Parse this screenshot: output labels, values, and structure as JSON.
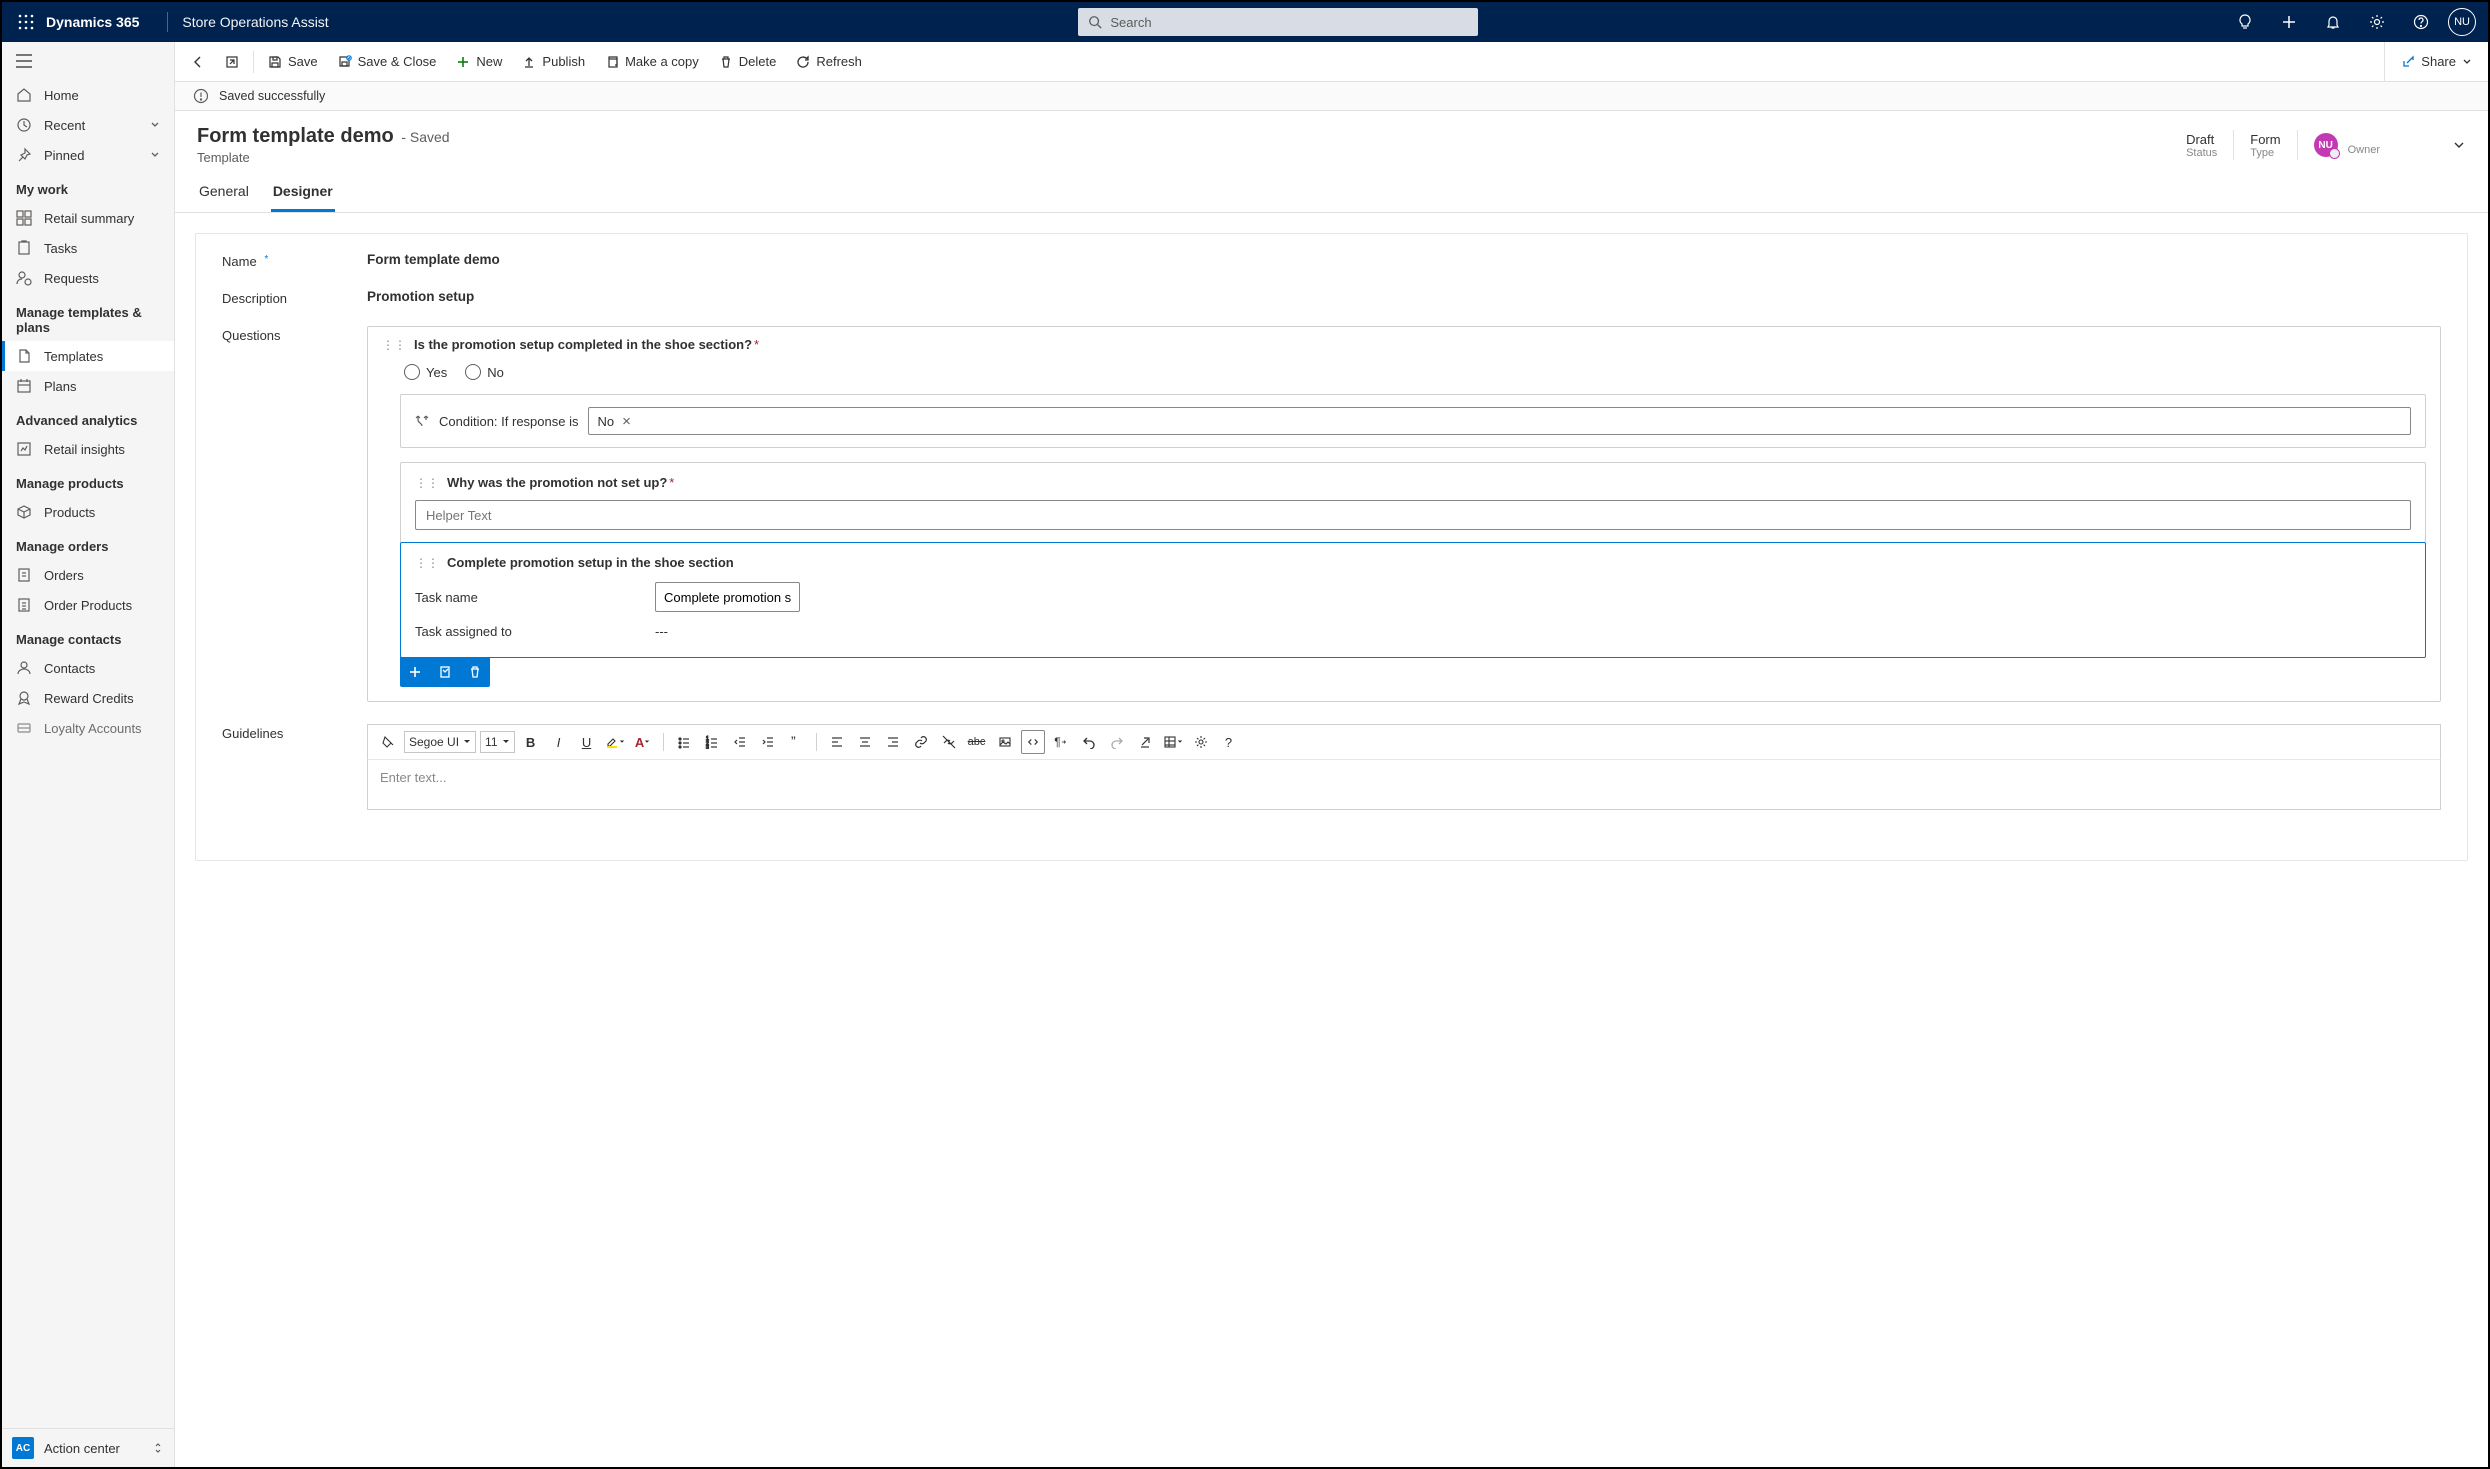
{
  "appbar": {
    "brand": "Dynamics 365",
    "appname": "Store Operations Assist",
    "search_placeholder": "Search",
    "user_initials": "NU"
  },
  "sidebar": {
    "top": [
      {
        "label": "Home",
        "icon": "home"
      },
      {
        "label": "Recent",
        "icon": "clock",
        "chev": true
      },
      {
        "label": "Pinned",
        "icon": "pin",
        "chev": true
      }
    ],
    "sections": [
      {
        "title": "My work",
        "items": [
          {
            "label": "Retail summary",
            "icon": "dashboard"
          },
          {
            "label": "Tasks",
            "icon": "task"
          },
          {
            "label": "Requests",
            "icon": "request"
          }
        ]
      },
      {
        "title": "Manage templates & plans",
        "items": [
          {
            "label": "Templates",
            "icon": "template",
            "active": true
          },
          {
            "label": "Plans",
            "icon": "plan"
          }
        ]
      },
      {
        "title": "Advanced analytics",
        "items": [
          {
            "label": "Retail insights",
            "icon": "insights"
          }
        ]
      },
      {
        "title": "Manage products",
        "items": [
          {
            "label": "Products",
            "icon": "product"
          }
        ]
      },
      {
        "title": "Manage orders",
        "items": [
          {
            "label": "Orders",
            "icon": "order"
          },
          {
            "label": "Order Products",
            "icon": "orderprod"
          }
        ]
      },
      {
        "title": "Manage contacts",
        "items": [
          {
            "label": "Contacts",
            "icon": "contact"
          },
          {
            "label": "Reward Credits",
            "icon": "reward"
          },
          {
            "label": "Loyalty Accounts",
            "icon": "loyalty"
          }
        ]
      }
    ],
    "action_center": {
      "badge": "AC",
      "label": "Action center"
    }
  },
  "commands": {
    "save": "Save",
    "save_close": "Save & Close",
    "new": "New",
    "publish": "Publish",
    "copy": "Make a copy",
    "delete": "Delete",
    "refresh": "Refresh",
    "share": "Share"
  },
  "statusbar": {
    "message": "Saved successfully"
  },
  "header": {
    "title": "Form template demo",
    "state": "- Saved",
    "subtitle": "Template",
    "status_value": "Draft",
    "status_label": "Status",
    "type_value": "Form",
    "type_label": "Type",
    "owner_initials": "NU",
    "owner_label": "Owner"
  },
  "tabs": {
    "general": "General",
    "designer": "Designer"
  },
  "form": {
    "name_label": "Name",
    "name_value": "Form template demo",
    "desc_label": "Description",
    "desc_value": "Promotion setup",
    "questions_label": "Questions",
    "guidelines_label": "Guidelines"
  },
  "question": {
    "text": "Is the promotion setup completed in the shoe section?",
    "opt_yes": "Yes",
    "opt_no": "No"
  },
  "condition": {
    "prefix": "Condition: If response is",
    "chip": "No"
  },
  "subq": {
    "text": "Why was the promotion not set up?",
    "placeholder": "Helper Text"
  },
  "task": {
    "title": "Complete promotion setup in the shoe section",
    "name_label": "Task name",
    "name_value": "Complete promotion s...",
    "assigned_label": "Task assigned to",
    "assigned_value": "---"
  },
  "rte": {
    "font": "Segoe UI",
    "size": "11",
    "placeholder": "Enter text..."
  }
}
